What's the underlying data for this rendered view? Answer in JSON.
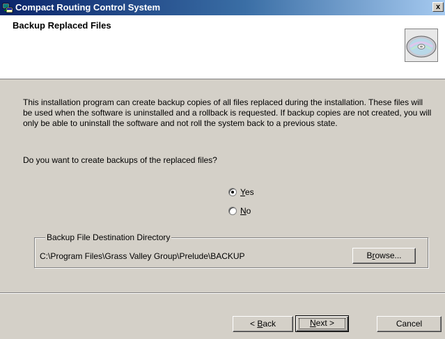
{
  "window": {
    "title": "Compact Routing Control System",
    "close_label": "x"
  },
  "header": {
    "title": "Backup Replaced Files"
  },
  "content": {
    "description": "This installation program can create backup copies of all files replaced during the installation. These files will be used when the software is uninstalled and a rollback is requested.  If backup copies are not created, you will only be able to uninstall the software and not roll the system back to a previous state.",
    "question": "Do you want to create backups of the replaced files?",
    "options": [
      {
        "label": "Yes",
        "mnemonic": "Y",
        "rest": "es",
        "selected": true
      },
      {
        "label": "No",
        "mnemonic": "N",
        "rest": "o",
        "selected": false
      }
    ]
  },
  "backup_dir": {
    "legend": "Backup File Destination Directory",
    "path": "C:\\Program Files\\Grass Valley Group\\Prelude\\BACKUP",
    "browse_label_pre": "B",
    "browse_label_mnemonic": "r",
    "browse_label_post": "owse..."
  },
  "footer": {
    "back_pre": "< ",
    "back_mnemonic": "B",
    "back_post": "ack",
    "next_mnemonic": "N",
    "next_post": "ext >",
    "cancel": "Cancel"
  }
}
